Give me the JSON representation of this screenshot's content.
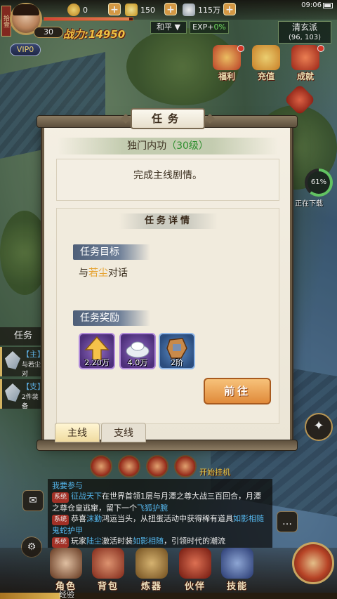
{
  "status": {
    "time": "09:06"
  },
  "player": {
    "seal": "拾壹",
    "level": "30",
    "power": "战力:14950",
    "vip": "VIP0"
  },
  "resources": [
    {
      "name": "gold",
      "value": "0"
    },
    {
      "name": "gold-ingot",
      "value": "150"
    },
    {
      "name": "silver",
      "value": "115万"
    }
  ],
  "mode": {
    "label": "和平"
  },
  "exp_bonus": {
    "label": "EXP+",
    "value": "0%"
  },
  "map": {
    "name": "清玄派",
    "coords": "(96, 103)"
  },
  "features": [
    {
      "label": "福利"
    },
    {
      "label": "充值"
    },
    {
      "label": "成就"
    }
  ],
  "progress": {
    "percent": 61,
    "text": "61%",
    "label": "正在下载"
  },
  "side_tasks": {
    "tab_label": "任务",
    "items": [
      {
        "tag": "【主】",
        "desc": "与若尘对"
      },
      {
        "tag": "【支】",
        "desc": "2件装备"
      }
    ]
  },
  "auto_battle": "开始挂机",
  "chat": {
    "header": "我要参与",
    "lines": [
      {
        "tag": "系统",
        "segments": [
          {
            "text": "征战天下",
            "color": "blue"
          },
          {
            "text": "在世界首领1层与月潭之尊大战三百回合，月潭之尊仓皇逃窜，留下一个",
            "color": "white"
          },
          {
            "text": "飞狐护腕",
            "color": "blue"
          }
        ]
      },
      {
        "tag": "系统",
        "segments": [
          {
            "text": "恭喜",
            "color": "white"
          },
          {
            "text": "沫勤",
            "color": "blue"
          },
          {
            "text": "鸿运当头，从扭蛋活动中获得稀有道具",
            "color": "white"
          },
          {
            "text": "如影相随",
            "color": "blue"
          },
          {
            "text": "鬼蛇护甲",
            "color": "blue"
          }
        ]
      },
      {
        "tag": "系统",
        "segments": [
          {
            "text": "玩家",
            "color": "white"
          },
          {
            "text": "陆尘",
            "color": "blue"
          },
          {
            "text": "激活时装",
            "color": "white"
          },
          {
            "text": "如影相随",
            "color": "blue"
          },
          {
            "text": "，引领时代的潮流",
            "color": "white"
          }
        ]
      }
    ]
  },
  "bottom_menu": [
    {
      "label": "角色"
    },
    {
      "label": "背包"
    },
    {
      "label": "炼器"
    },
    {
      "label": "伙伴"
    },
    {
      "label": "技能"
    }
  ],
  "exp_label": "经验",
  "dialog": {
    "title": "任务",
    "quest_name": "独门内功",
    "quest_level": "（30级）",
    "description": "完成主线剧情。",
    "detail_title": "任务详情",
    "goal_label": "任务目标",
    "goal_prefix": "与",
    "goal_target": "若尘",
    "goal_suffix": "对话",
    "reward_label": "任务奖励",
    "rewards": [
      {
        "name": "经验",
        "amount": "2.20万"
      },
      {
        "name": "银两",
        "amount": "4.0万"
      },
      {
        "name": "装备",
        "amount": "2阶"
      }
    ],
    "go_button": "前往",
    "tabs": [
      "主线",
      "支线"
    ]
  }
}
